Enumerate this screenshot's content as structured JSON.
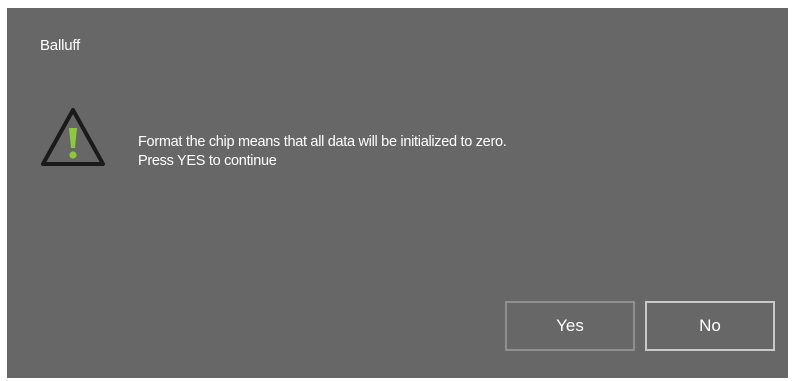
{
  "dialog": {
    "title": "Balluff",
    "icon": "warning-triangle-icon",
    "message_lines": [
      "Format the chip means that all data will be initialized to zero.",
      "Press YES to continue"
    ],
    "buttons": {
      "yes_label": "Yes",
      "no_label": "No"
    }
  },
  "colors": {
    "dialog_background": "#676767",
    "text": "#ffffff",
    "icon_outline": "#1a1a1a",
    "icon_exclamation": "#8dc63f"
  }
}
